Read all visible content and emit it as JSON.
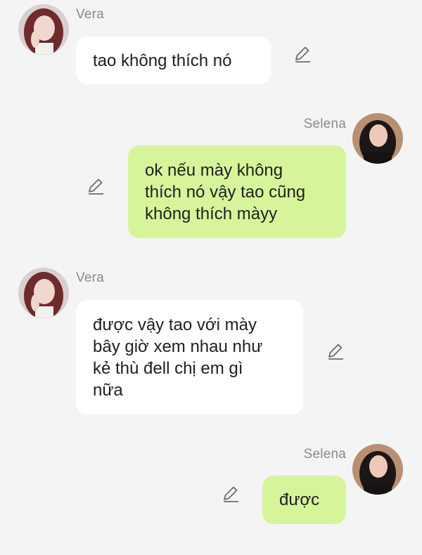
{
  "colors": {
    "background": "#f4f4f4",
    "incoming_bubble": "#ffffff",
    "outgoing_bubble": "#d6f59a",
    "sender_name": "#8a8a8a",
    "text": "#1f1f1f"
  },
  "messages": [
    {
      "sender": "Vera",
      "side": "left",
      "text": "tao không thích nó",
      "icon": "edit-icon"
    },
    {
      "sender": "Selena",
      "side": "right",
      "text": "ok nếu mày không\nthích nó vậy tao cũng\nkhông thích màyy",
      "icon": "edit-icon"
    },
    {
      "sender": "Vera",
      "side": "left",
      "text": "được vậy tao với mày\nbây giờ xem nhau như\nkẻ thù đell chị em gì\nnữa",
      "icon": "edit-icon"
    },
    {
      "sender": "Selena",
      "side": "right",
      "text": "được",
      "icon": "edit-icon"
    }
  ]
}
